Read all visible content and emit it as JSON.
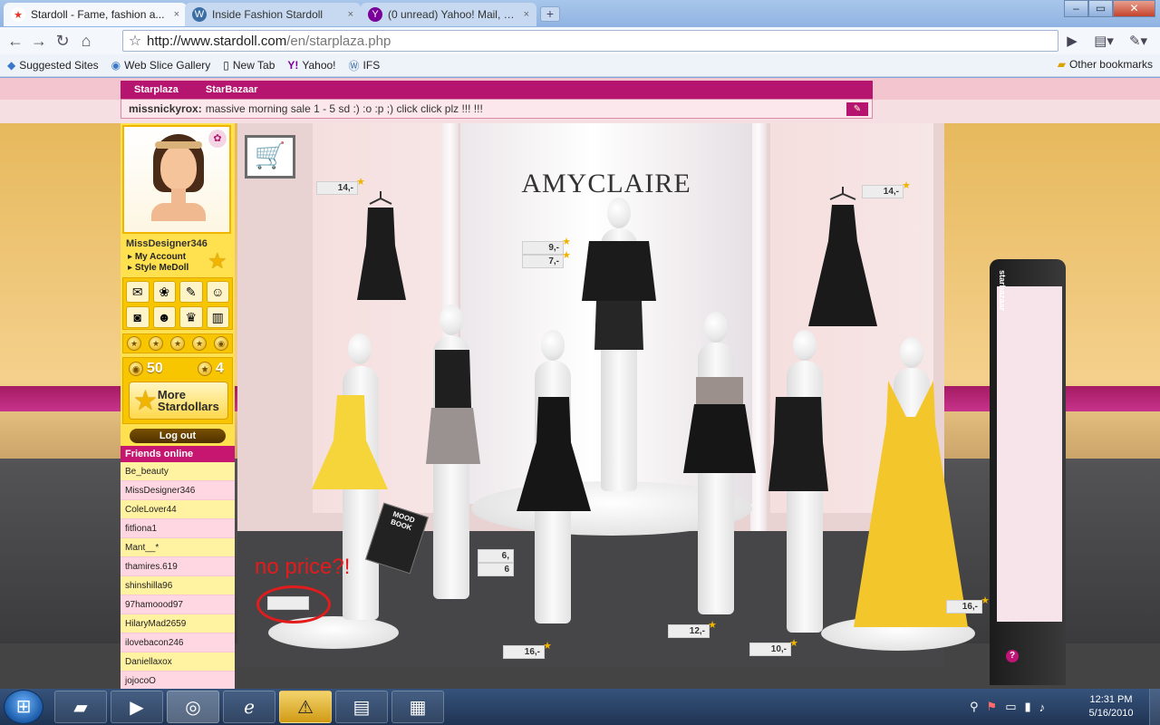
{
  "browser": {
    "tabs": [
      {
        "label": "Stardoll - Fame, fashion a...",
        "icon": "star-icon",
        "close": "×"
      },
      {
        "label": "Inside Fashion Stardoll",
        "icon": "wordpress-icon",
        "close": "×"
      },
      {
        "label": "(0 unread) Yahoo! Mail, h...",
        "icon": "yahoo-icon",
        "close": "×"
      }
    ],
    "newtab_glyph": "+",
    "url_host": "http://www.stardoll.com",
    "url_path": "/en/starplaza.php",
    "bookmarks": [
      {
        "label": "Suggested Sites",
        "icon": "suggested-sites-icon"
      },
      {
        "label": "Web Slice Gallery",
        "icon": "web-slice-icon"
      },
      {
        "label": "New Tab",
        "icon": "page-icon"
      },
      {
        "label": "Yahoo!",
        "icon": "yahoo-icon"
      },
      {
        "label": "IFS",
        "icon": "wordpress-icon"
      }
    ],
    "other_bookmarks": "Other bookmarks",
    "window_controls": {
      "minimize": "–",
      "maximize": "▭",
      "close": "✕"
    }
  },
  "site": {
    "nav_tabs": [
      "Starplaza",
      "StarBazaar"
    ],
    "ticker_user": "missnickyrox:",
    "ticker_text": "massive morning sale 1 - 5 sd :) :o :p ;) click click plz !!! !!!",
    "ticker_btn": "✎",
    "brand": "AMYCLAIRE",
    "moodbook": "MOOD BOOK",
    "kiosk_label": "starbazaar",
    "help": "?",
    "cart_icon": "🛒",
    "annotation": "no price?!"
  },
  "prices": [
    {
      "text": "14,-"
    },
    {
      "text": "9,-"
    },
    {
      "text": "7,-"
    },
    {
      "text": "14,-"
    },
    {
      "text": "6,"
    },
    {
      "text": "6"
    },
    {
      "text": "16,-"
    },
    {
      "text": "12,-"
    },
    {
      "text": "10,-"
    },
    {
      "text": "16,-"
    },
    {
      "text": ""
    }
  ],
  "sidebar": {
    "username": "MissDesigner346",
    "my_account": "My Account",
    "style_medoll": "Style MeDoll",
    "starcoins": "50",
    "stardollars": "4",
    "more_label_line1": "More",
    "more_label_line2": "Stardollars",
    "logout": "Log out",
    "friends_title": "Friends online",
    "friends": [
      "Be_beauty",
      "MissDesigner346",
      "ColeLover44",
      "fitfiona1",
      "Mant__*",
      "thamires.619",
      "shinshilla96",
      "97hamoood97",
      "HilaryMad2659",
      "ilovebacon246",
      "Daniellaxox",
      "jojocoO"
    ]
  },
  "taskbar": {
    "clock_time": "12:31 PM",
    "clock_date": "5/16/2010"
  },
  "colors": {
    "brand_pink": "#b6156f",
    "sidebar_yellow": "#ffe14f",
    "annotation_red": "#e21c1c"
  }
}
